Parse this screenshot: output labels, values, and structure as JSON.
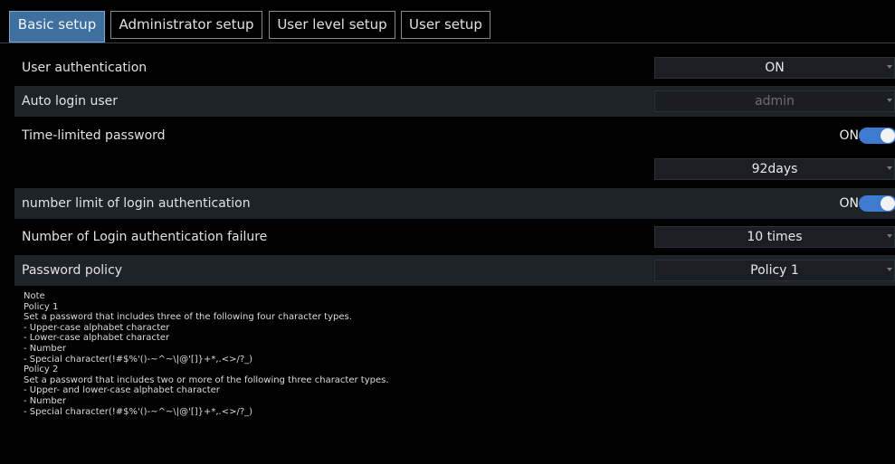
{
  "tabs": [
    {
      "label": "Basic setup",
      "active": true
    },
    {
      "label": "Administrator setup",
      "active": false
    },
    {
      "label": "User level setup",
      "active": false
    },
    {
      "label": "User setup",
      "active": false
    }
  ],
  "rows": {
    "user_authentication": {
      "label": "User authentication",
      "value": "ON"
    },
    "auto_login_user": {
      "label": "Auto login user",
      "value": "admin"
    },
    "time_limited_password": {
      "label": "Time-limited password",
      "toggle_text": "ON",
      "toggle_on": true
    },
    "password_period": {
      "value": "92days"
    },
    "login_limit": {
      "label": "number limit of login authentication",
      "toggle_text": "ON",
      "toggle_on": true
    },
    "login_failure": {
      "label": "Number of Login authentication failure",
      "value": "10 times"
    },
    "password_policy": {
      "label": "Password policy",
      "value": "Policy 1"
    }
  },
  "note": {
    "lines": [
      "Note",
      "Policy 1",
      "Set a password that includes three of the following four character types.",
      "- Upper-case alphabet character",
      "- Lower-case alphabet character",
      "- Number",
      "- Special character(!#$%'()-~^~\\|@'[]}+*,.<>/?_)",
      "Policy 2",
      "Set a password that includes two or more of the following three character types.",
      "- Upper- and lower-case alphabet character",
      "- Number",
      "- Special character(!#$%'()-~^~\\|@'[]}+*,.<>/?_)"
    ]
  },
  "colors": {
    "active_tab": "#3f6f9e",
    "toggle_on": "#3d7ad0",
    "row_shade": "#1e2328",
    "background": "#000000"
  }
}
